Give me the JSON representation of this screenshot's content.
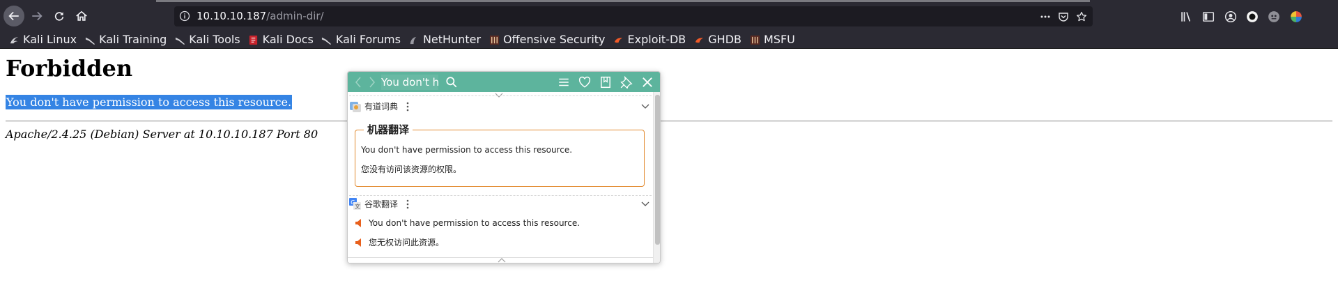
{
  "browser": {
    "url_host": "10.10.10.187",
    "url_path": "/admin-dir/",
    "bookmarks": [
      {
        "label": "Kali Linux",
        "icon": "kali-dragon-icon"
      },
      {
        "label": "Kali Training",
        "icon": "kali-dragon-icon"
      },
      {
        "label": "Kali Tools",
        "icon": "kali-dragon-icon"
      },
      {
        "label": "Kali Docs",
        "icon": "kali-docs-icon"
      },
      {
        "label": "Kali Forums",
        "icon": "kali-dragon-icon"
      },
      {
        "label": "NetHunter",
        "icon": "nethunter-icon"
      },
      {
        "label": "Offensive Security",
        "icon": "offsec-icon"
      },
      {
        "label": "Exploit-DB",
        "icon": "exploitdb-icon"
      },
      {
        "label": "GHDB",
        "icon": "ghdb-icon"
      },
      {
        "label": "MSFU",
        "icon": "msfu-icon"
      }
    ]
  },
  "page": {
    "title": "Forbidden",
    "message": "You don't have permission to access this resource.",
    "address": "Apache/2.4.25 (Debian) Server at 10.10.10.187 Port 80"
  },
  "popup": {
    "search_value": "You don't h",
    "youdao": {
      "name": "有道词典",
      "section_title": "机器翻译",
      "source": "You don't have permission to access this resource.",
      "result": "您没有访问该资源的权限。"
    },
    "google": {
      "name": "谷歌翻译",
      "source": "You don't have permission to access this resource.",
      "result": "您无权访问此资源。"
    }
  },
  "colors": {
    "chrome_bg": "#2b2a33",
    "urlbar_bg": "#1c1b22",
    "selection": "#3584e4",
    "popup_header": "#5db49d",
    "machine_border": "#e28a2f",
    "speaker": "#e8601c"
  }
}
